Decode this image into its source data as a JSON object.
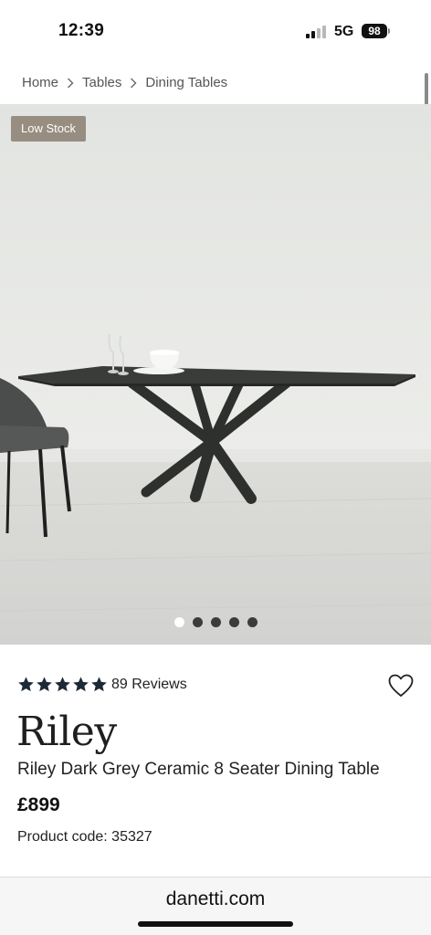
{
  "status_bar": {
    "time": "12:39",
    "network": "5G",
    "battery": "98"
  },
  "breadcrumb": [
    {
      "label": "Home"
    },
    {
      "label": "Tables"
    },
    {
      "label": "Dining Tables"
    }
  ],
  "hero": {
    "badge": "Low Stock",
    "image_icon": "dining-table-photo",
    "slide_count": 5,
    "active_slide": 1
  },
  "product": {
    "rating": 5,
    "reviews_label": "89 Reviews",
    "brand": "Riley",
    "name": "Riley Dark Grey Ceramic 8 Seater Dining Table",
    "price": "£899",
    "product_code": "Product code: 35327"
  },
  "browser": {
    "url": "danetti.com"
  },
  "colors": {
    "badge_bg": "#978d80",
    "star": "#1d2a36",
    "text": "#1a1a1a"
  }
}
